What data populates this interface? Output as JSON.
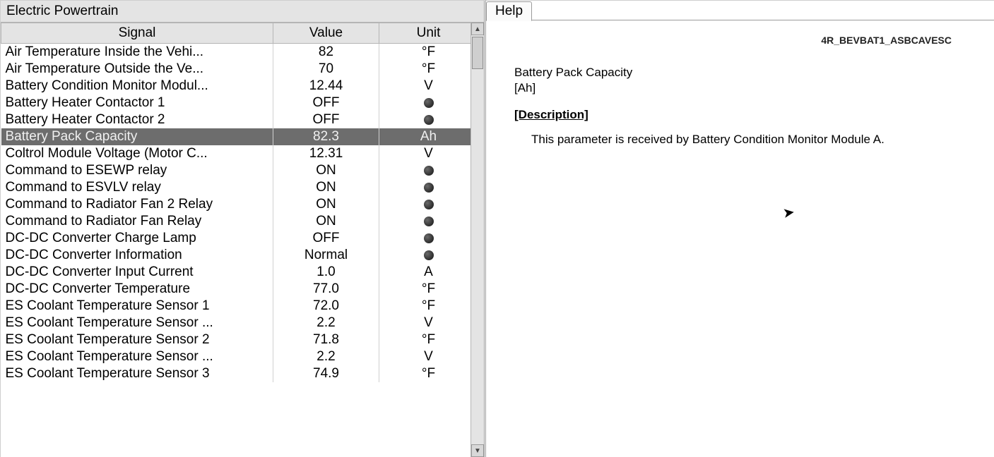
{
  "left": {
    "title": "Electric Powertrain",
    "headers": {
      "signal": "Signal",
      "value": "Value",
      "unit": "Unit"
    },
    "rows": [
      {
        "signal": "Air Temperature Inside the Vehi...",
        "value": "82",
        "unit": "°F",
        "led": false,
        "selected": false
      },
      {
        "signal": "Air Temperature Outside the Ve...",
        "value": "70",
        "unit": "°F",
        "led": false,
        "selected": false
      },
      {
        "signal": "Battery Condition Monitor Modul...",
        "value": "12.44",
        "unit": "V",
        "led": false,
        "selected": false
      },
      {
        "signal": "Battery Heater Contactor 1",
        "value": "OFF",
        "unit": "",
        "led": true,
        "selected": false
      },
      {
        "signal": "Battery Heater Contactor 2",
        "value": "OFF",
        "unit": "",
        "led": true,
        "selected": false
      },
      {
        "signal": "Battery Pack Capacity",
        "value": "82.3",
        "unit": "Ah",
        "led": false,
        "selected": true
      },
      {
        "signal": "Coltrol Module Voltage (Motor C...",
        "value": "12.31",
        "unit": "V",
        "led": false,
        "selected": false
      },
      {
        "signal": "Command to ESEWP relay",
        "value": "ON",
        "unit": "",
        "led": true,
        "selected": false
      },
      {
        "signal": "Command to ESVLV relay",
        "value": "ON",
        "unit": "",
        "led": true,
        "selected": false
      },
      {
        "signal": "Command to Radiator Fan 2 Relay",
        "value": "ON",
        "unit": "",
        "led": true,
        "selected": false
      },
      {
        "signal": "Command to Radiator Fan Relay",
        "value": "ON",
        "unit": "",
        "led": true,
        "selected": false
      },
      {
        "signal": "DC-DC Converter Charge Lamp",
        "value": "OFF",
        "unit": "",
        "led": true,
        "selected": false
      },
      {
        "signal": "DC-DC Converter Information",
        "value": "Normal",
        "unit": "",
        "led": true,
        "selected": false
      },
      {
        "signal": "DC-DC Converter Input Current",
        "value": "1.0",
        "unit": "A",
        "led": false,
        "selected": false
      },
      {
        "signal": "DC-DC Converter Temperature",
        "value": "77.0",
        "unit": "°F",
        "led": false,
        "selected": false
      },
      {
        "signal": "ES Coolant Temperature Sensor 1",
        "value": "72.0",
        "unit": "°F",
        "led": false,
        "selected": false
      },
      {
        "signal": "ES Coolant Temperature Sensor ...",
        "value": "2.2",
        "unit": "V",
        "led": false,
        "selected": false
      },
      {
        "signal": "ES Coolant Temperature Sensor 2",
        "value": "71.8",
        "unit": "°F",
        "led": false,
        "selected": false
      },
      {
        "signal": "ES Coolant Temperature Sensor ...",
        "value": "2.2",
        "unit": "V",
        "led": false,
        "selected": false
      },
      {
        "signal": "ES Coolant Temperature Sensor 3",
        "value": "74.9",
        "unit": "°F",
        "led": false,
        "selected": false
      }
    ]
  },
  "right": {
    "tab": "Help",
    "code": "4R_BEVBAT1_ASBCAVESC",
    "param_name": "Battery Pack Capacity",
    "param_unit": "[Ah]",
    "desc_heading": "[Description]",
    "desc_body": "This parameter is received by Battery Condition Monitor Module A."
  }
}
